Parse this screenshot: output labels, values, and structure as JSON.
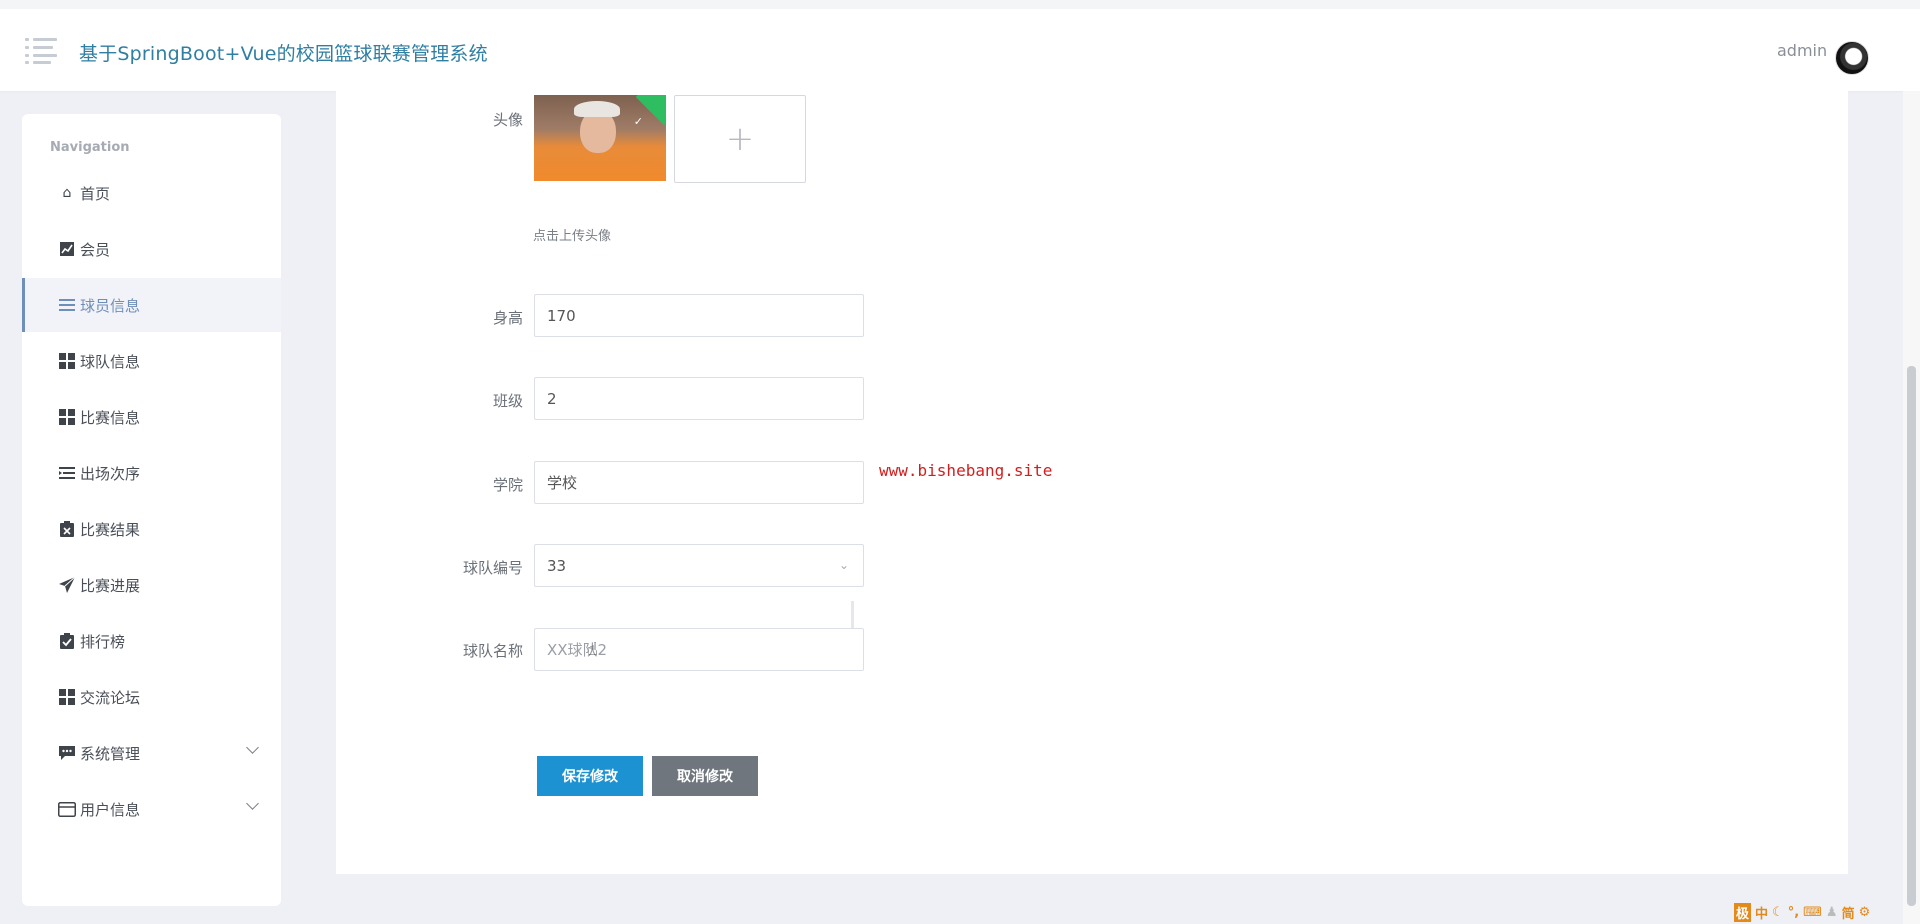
{
  "header": {
    "title": "基于SpringBoot+Vue的校园篮球联赛管理系统",
    "username": "admin"
  },
  "sidebar": {
    "heading": "Navigation",
    "items": [
      {
        "label": "首页",
        "icon": "home-icon"
      },
      {
        "label": "会员",
        "icon": "chart-icon"
      },
      {
        "label": "球员信息",
        "icon": "list-icon",
        "active": true
      },
      {
        "label": "球队信息",
        "icon": "grid-icon"
      },
      {
        "label": "比赛信息",
        "icon": "grid-icon"
      },
      {
        "label": "出场次序",
        "icon": "indent-icon"
      },
      {
        "label": "比赛结果",
        "icon": "clipboard-x-icon"
      },
      {
        "label": "比赛进展",
        "icon": "paper-plane-icon"
      },
      {
        "label": "排行榜",
        "icon": "clipboard-check-icon"
      },
      {
        "label": "交流论坛",
        "icon": "grid-icon"
      },
      {
        "label": "系统管理",
        "icon": "comment-icon",
        "expandable": true
      },
      {
        "label": "用户信息",
        "icon": "card-icon",
        "expandable": true
      }
    ]
  },
  "form": {
    "avatar_label": "头像",
    "upload_hint": "点击上传头像",
    "upload_plus": "+",
    "height_label": "身高",
    "height_value": "170",
    "class_label": "班级",
    "class_value": "2",
    "college_label": "学院",
    "college_value": "学校",
    "team_no_label": "球队编号",
    "team_no_value": "33",
    "team_name_label": "球队名称",
    "team_name_value": "XX球队2",
    "save_label": "保存修改",
    "cancel_label": "取消修改"
  },
  "watermark": "www.bishebang.site",
  "ime": [
    "极",
    "中",
    "简"
  ],
  "colors": {
    "brand": "#2f7ea3",
    "save_button": "#1d92d2",
    "cancel_button": "#6f767d",
    "active_nav": "#6f8fb8",
    "watermark": "#d01f1f"
  }
}
